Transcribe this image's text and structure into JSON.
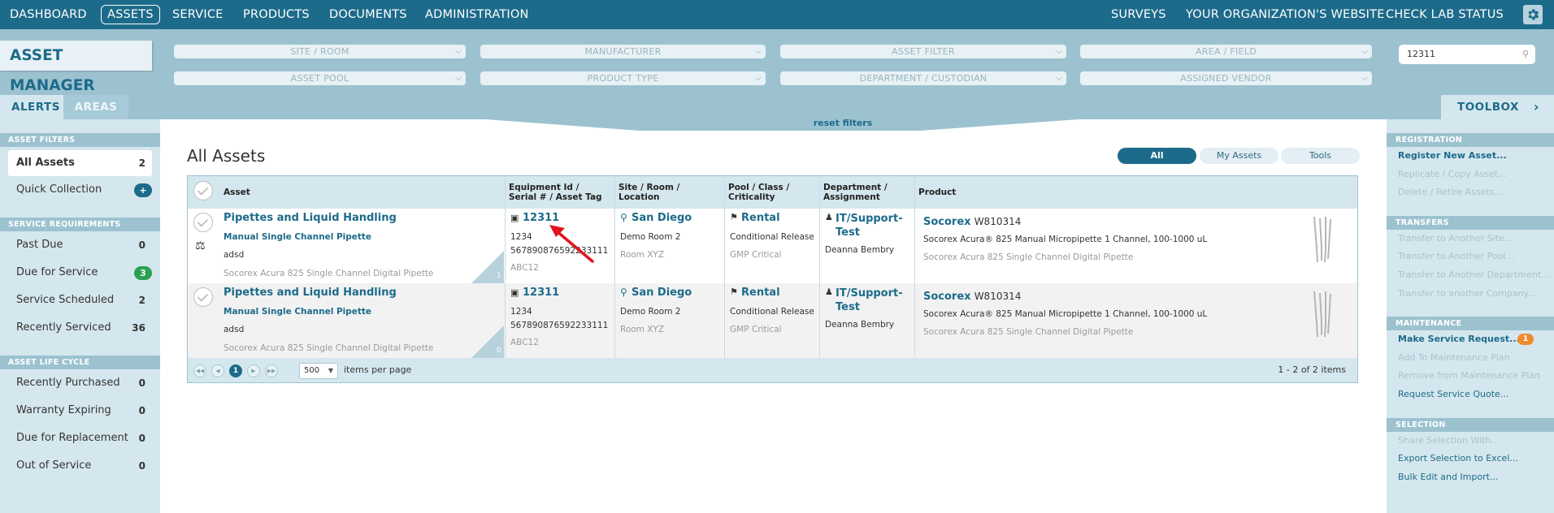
{
  "nav": {
    "left": [
      "DASHBOARD",
      "ASSETS",
      "SERVICE",
      "PRODUCTS",
      "DOCUMENTS",
      "ADMINISTRATION"
    ],
    "active": "ASSETS",
    "right": [
      "SURVEYS",
      "YOUR ORGANIZATION'S WEBSITE",
      "CHECK LAB STATUS"
    ],
    "settings_icon": "gear-icon"
  },
  "app_title": "ASSET MANAGER",
  "filters": {
    "row1": [
      "SITE / ROOM",
      "MANUFACTURER",
      "ASSET FILTER",
      "AREA / FIELD"
    ],
    "row2": [
      "ASSET POOL",
      "PRODUCT TYPE",
      "DEPARTMENT / CUSTODIAN",
      "ASSIGNED VENDOR"
    ],
    "search_value": "12311",
    "reset_label": "reset filters"
  },
  "tabs": {
    "alerts": "ALERTS",
    "areas": "AREAS",
    "toolbox": "TOOLBOX"
  },
  "left_sidebar": {
    "asset_filters_title": "ASSET FILTERS",
    "all_assets": {
      "label": "All Assets",
      "count": "2"
    },
    "quick_collection": {
      "label": "Quick Collection",
      "badge": "+"
    },
    "service_title": "SERVICE REQUIREMENTS",
    "service": [
      {
        "label": "Past Due",
        "count": "0"
      },
      {
        "label": "Due for Service",
        "count": "3"
      },
      {
        "label": "Service Scheduled",
        "count": "2"
      },
      {
        "label": "Recently Serviced",
        "count": "36"
      }
    ],
    "lifecycle_title": "ASSET LIFE CYCLE",
    "lifecycle": [
      {
        "label": "Recently Purchased",
        "count": "0"
      },
      {
        "label": "Warranty Expiring",
        "count": "0"
      },
      {
        "label": "Due for Replacement",
        "count": "0"
      },
      {
        "label": "Out of Service",
        "count": "0"
      }
    ]
  },
  "main": {
    "title": "All Assets",
    "segments": [
      "All",
      "My Assets",
      "Tools"
    ],
    "columns": {
      "asset": "Asset",
      "equipment": "Equipment Id / Serial # / Asset Tag",
      "site": "Site / Room / Location",
      "pool": "Pool / Class / Criticality",
      "dept": "Department / Assignment",
      "product": "Product"
    },
    "rows": [
      {
        "asset_name": "Pipettes and Liquid Handling",
        "asset_type": "Manual Single Channel Pipette",
        "asset_note": "adsd",
        "asset_desc": "Socorex Acura 825 Single Channel Digital Pipette",
        "corner": "1",
        "equipment_id": "12311",
        "serial": "1234",
        "serial2": "567890876592233111",
        "tag": "ABC12",
        "site": "San Diego",
        "room": "Demo Room 2",
        "location": "Room XYZ",
        "pool": "Rental",
        "class": "Conditional Release",
        "criticality": "GMP Critical",
        "dept": "IT/Support-Test",
        "assignee": "Deanna Bembry",
        "brand": "Socorex",
        "model": "W810314",
        "product_name": "Socorex Acura® 825 Manual Micropipette 1 Channel, 100-1000 uL",
        "product_desc": "Socorex Acura 825 Single Channel Digital Pipette"
      },
      {
        "asset_name": "Pipettes and Liquid Handling",
        "asset_type": "Manual Single Channel Pipette",
        "asset_note": "adsd",
        "asset_desc": "Socorex Acura 825 Single Channel Digital Pipette",
        "corner": "0",
        "equipment_id": "12311",
        "serial": "1234",
        "serial2": "567890876592233111",
        "tag": "ABC12",
        "site": "San Diego",
        "room": "Demo Room 2",
        "location": "Room XYZ",
        "pool": "Rental",
        "class": "Conditional Release",
        "criticality": "GMP Critical",
        "dept": "IT/Support-Test",
        "assignee": "Deanna Bembry",
        "brand": "Socorex",
        "model": "W810314",
        "product_name": "Socorex Acura® 825 Manual Micropipette 1 Channel, 100-1000 uL",
        "product_desc": "Socorex Acura 825 Single Channel Digital Pipette"
      }
    ],
    "pager": {
      "current_page": "1",
      "page_size": "500",
      "page_size_label": "items per page",
      "count_text": "1 - 2 of 2 items"
    }
  },
  "toolbox": {
    "registration_title": "REGISTRATION",
    "registration": [
      "Register New Asset...",
      "Replicate / Copy Asset...",
      "Delete / Retire Assets..."
    ],
    "transfers_title": "TRANSFERS",
    "transfers": [
      "Transfer to Another Site...",
      "Transfer to Another Pool...",
      "Transfer to Another Department...",
      "Transfer to another Company..."
    ],
    "maintenance_title": "MAINTENANCE",
    "maintenance": [
      "Make Service Request...",
      "Add To Maintenance Plan",
      "Remove from Maintenance Plan",
      "Request Service Quote..."
    ],
    "maintenance_badge": "1",
    "selection_title": "SELECTION",
    "selection": [
      "Share Selection With...",
      "Export Selection to Excel...",
      "Bulk Edit and Import..."
    ]
  },
  "colors": {
    "primary": "#1d6b8a",
    "band": "#9cc2d0",
    "panel": "#d5e7ee",
    "green": "#2aa152",
    "orange": "#f08a2a",
    "annotation": "#e0141e"
  }
}
